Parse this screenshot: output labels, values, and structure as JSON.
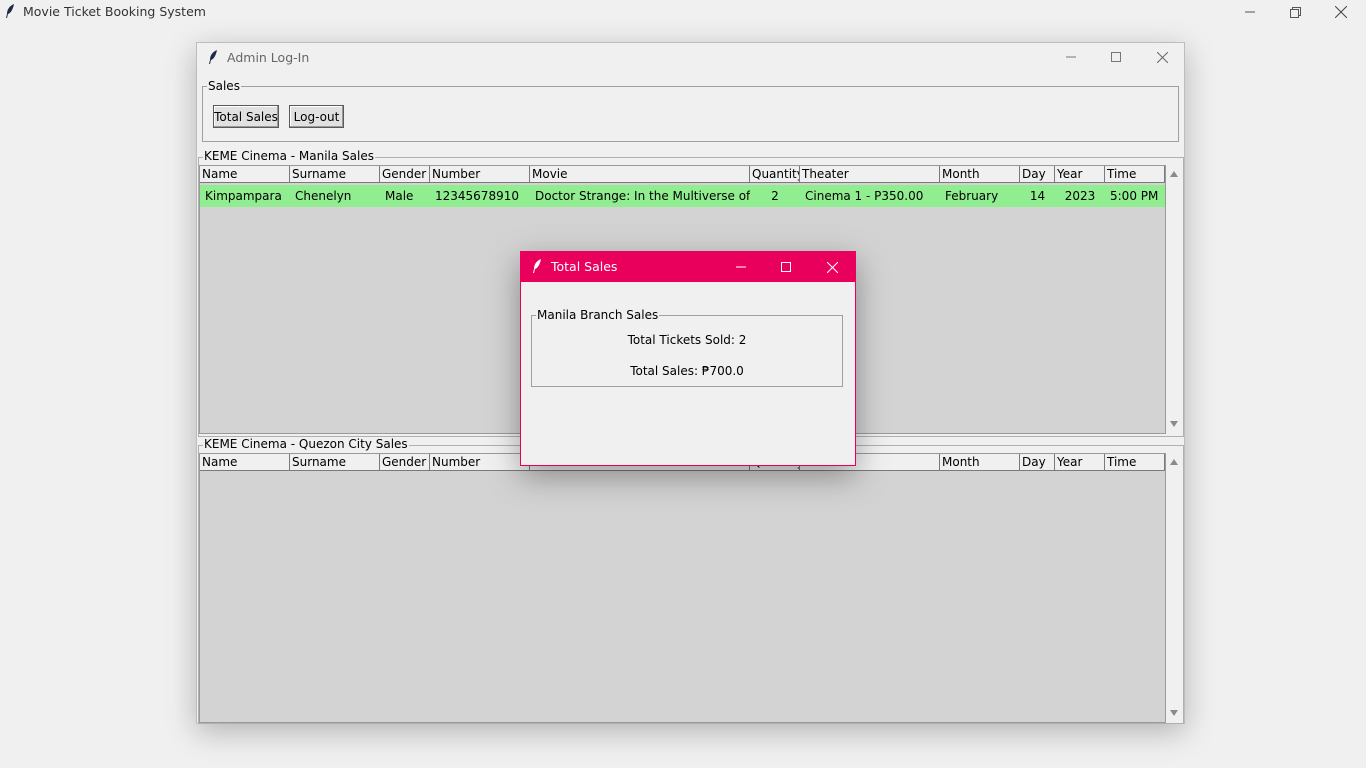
{
  "main_window": {
    "title": "Movie Ticket Booking System"
  },
  "admin_window": {
    "title": "Admin Log-In",
    "sales_group": {
      "label": "Sales",
      "total_sales_button": "Total Sales",
      "logout_button": "Log-out"
    },
    "columns": [
      "Name",
      "Surname",
      "Gender",
      "Number",
      "Movie",
      "Quantity",
      "Theater",
      "Month",
      "Day",
      "Year",
      "Time"
    ],
    "manila": {
      "label": "KEME Cinema - Manila Sales",
      "rows": [
        {
          "name": "Kimpampara",
          "surname": "Chenelyn",
          "gender": "Male",
          "number": "12345678910",
          "movie": "Doctor Strange: In the Multiverse of Mac",
          "quantity": "2",
          "theater": "Cinema 1 - P350.00",
          "month": "February",
          "day": "14",
          "year": "2023",
          "time": "5:00 PM"
        }
      ]
    },
    "quezon": {
      "label": "KEME Cinema - Quezon City Sales",
      "rows": []
    }
  },
  "total_sales_dialog": {
    "title": "Total Sales",
    "group_label": "Manila Branch Sales",
    "tickets_sold": "Total Tickets Sold: 2",
    "total_sales": "Total Sales: ₱700.0"
  },
  "colors": {
    "row_highlight": "#90ee90",
    "dialog_accent": "#e8005c",
    "tree_background": "#d3d3d3"
  },
  "icons": {
    "app_icon": "feather-icon",
    "minimize": "minimize-icon",
    "maximize": "maximize-icon",
    "restore": "restore-icon",
    "close": "close-icon"
  }
}
